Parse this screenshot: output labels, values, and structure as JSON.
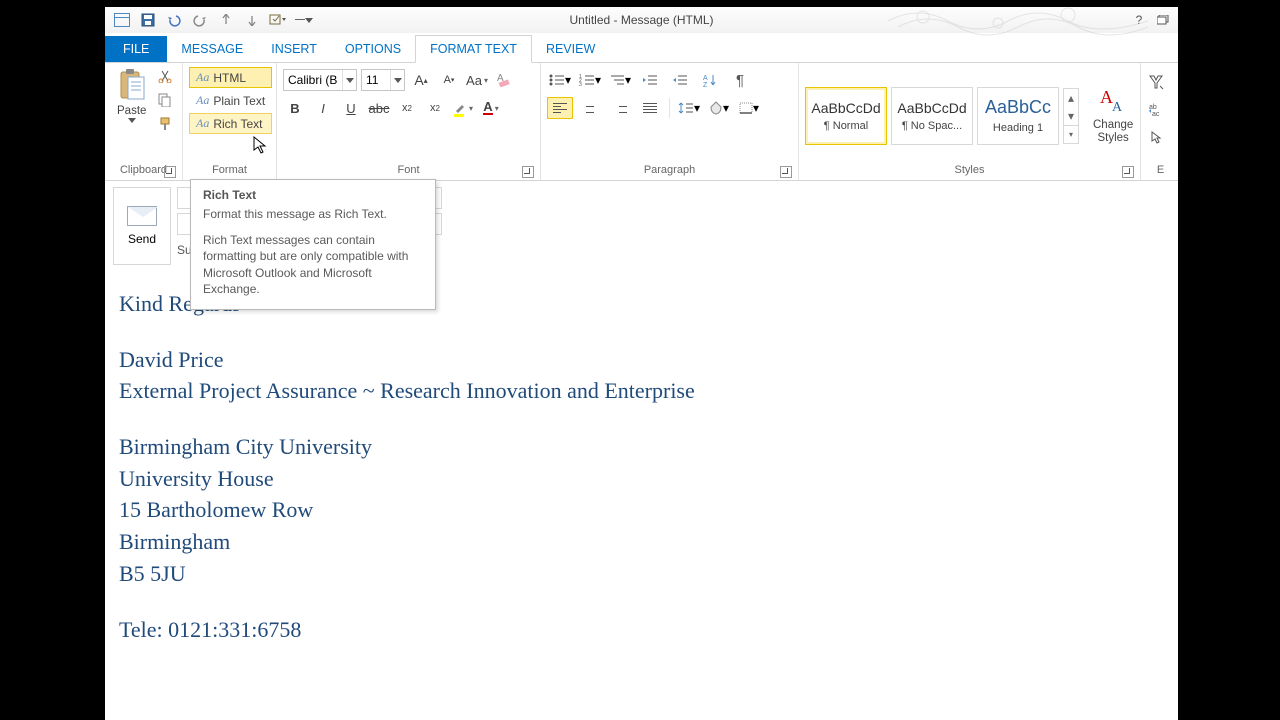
{
  "title": "Untitled - Message (HTML)",
  "tabs": {
    "file": "FILE",
    "message": "MESSAGE",
    "insert": "INSERT",
    "options": "OPTIONS",
    "format_text": "FORMAT TEXT",
    "review": "REVIEW"
  },
  "ribbon": {
    "clipboard": {
      "label": "Clipboard",
      "paste": "Paste"
    },
    "format": {
      "label": "Format",
      "html": "HTML",
      "plain": "Plain Text",
      "rich": "Rich Text"
    },
    "font": {
      "label": "Font",
      "name": "Calibri (B",
      "size": "11"
    },
    "paragraph": {
      "label": "Paragraph"
    },
    "styles": {
      "label": "Styles",
      "change": "Change\nStyles",
      "items": [
        {
          "name": "¶ Normal",
          "preview": "AaBbCcDd"
        },
        {
          "name": "¶ No Spac...",
          "preview": "AaBbCcDd"
        },
        {
          "name": "Heading 1",
          "preview": "AaBbCc"
        }
      ]
    },
    "editing": {
      "label": "E"
    }
  },
  "tooltip": {
    "title": "Rich Text",
    "line1": "Format this message as Rich Text.",
    "line2": "Rich Text messages can contain formatting but are only compatible with Microsoft Outlook and Microsoft Exchange."
  },
  "send": "Send",
  "fields": {
    "subject": "Su"
  },
  "body": {
    "greeting": "Kind Regards",
    "name": "David Price",
    "role": "External Project Assurance ~ Research Innovation and Enterprise",
    "addr1": "Birmingham City University",
    "addr2": "University House",
    "addr3": "15 Bartholomew Row",
    "addr4": "Birmingham",
    "addr5": "B5 5JU",
    "tele": "Tele: 0121:331:6758"
  }
}
